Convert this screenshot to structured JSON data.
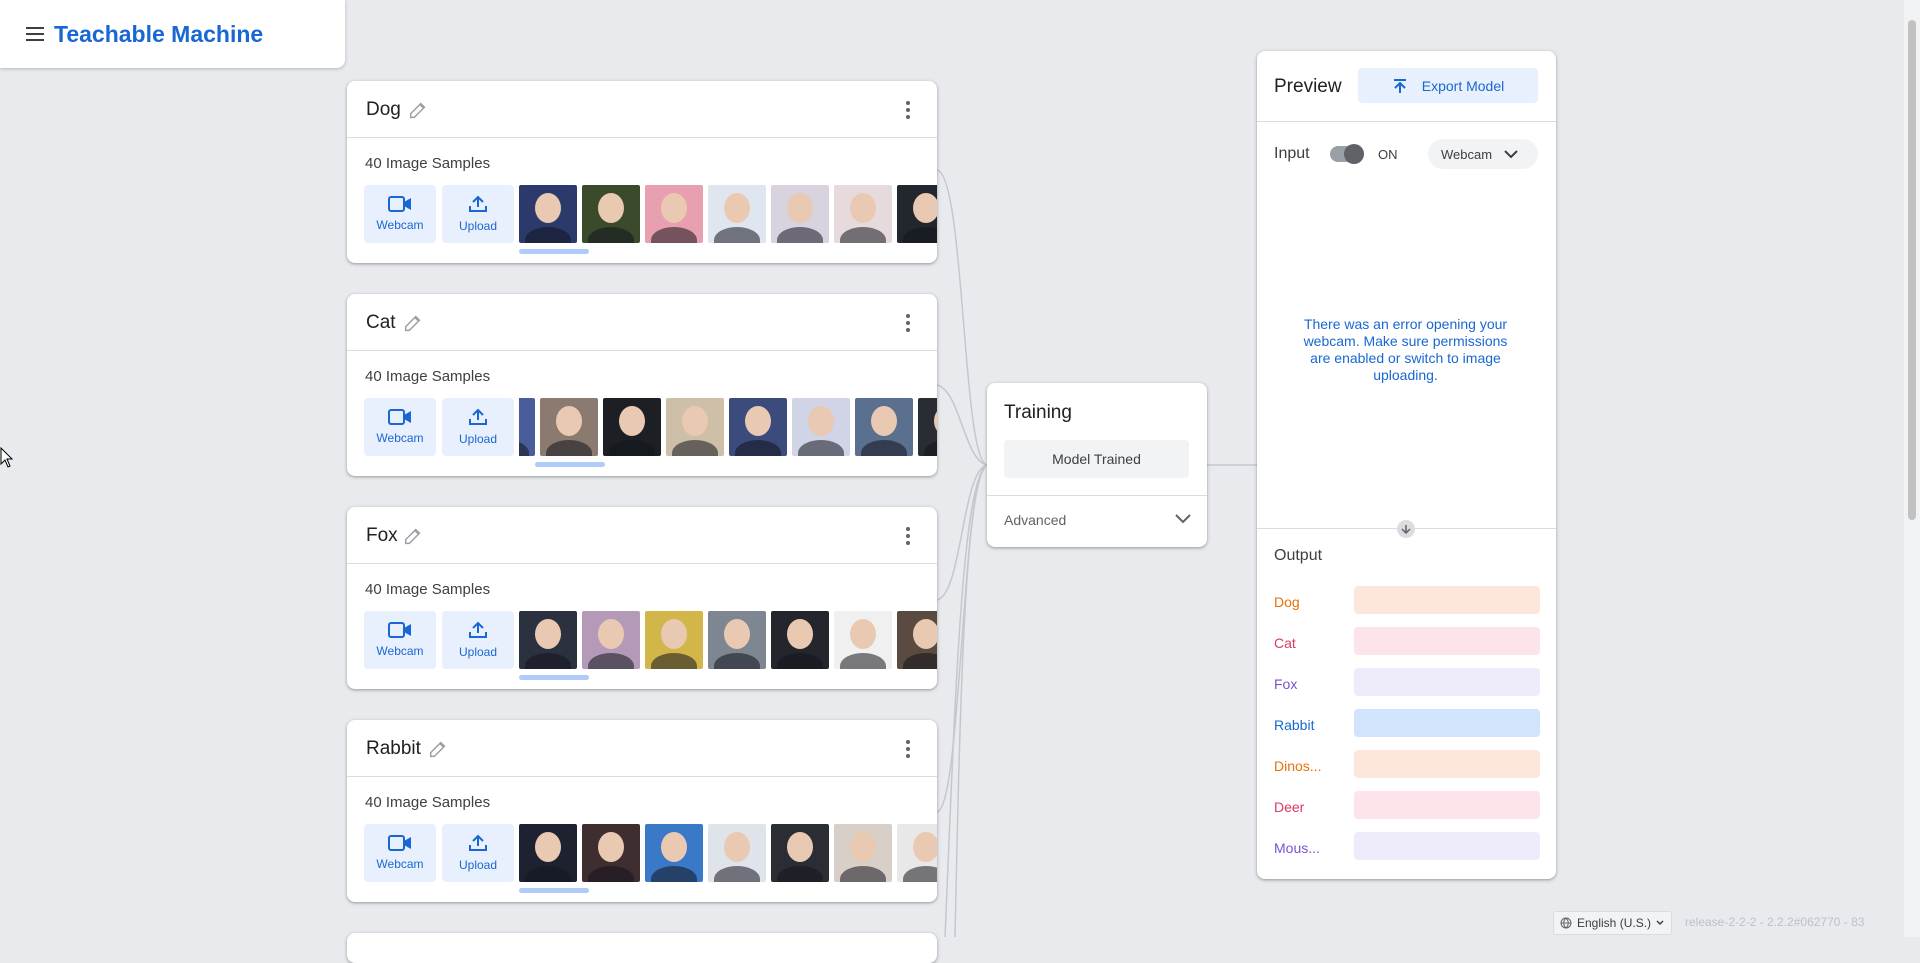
{
  "app": {
    "title": "Teachable Machine"
  },
  "classes": [
    {
      "name": "Dog",
      "samples_label": "40 Image Samples",
      "webcam_label": "Webcam",
      "upload_label": "Upload",
      "thumb_colors": [
        "#2b3a6b",
        "#3a4a2a",
        "#e8a0b0",
        "#dfe6f0",
        "#d9d3df",
        "#e6dadd",
        "#22262e"
      ]
    },
    {
      "name": "Cat",
      "samples_label": "40 Image Samples",
      "webcam_label": "Webcam",
      "upload_label": "Upload",
      "thumb_colors": [
        "#4a5d9a",
        "#8a7a70",
        "#1c1f24",
        "#cdbfa8",
        "#3b4b7c",
        "#d0d4e6",
        "#5b6f8e",
        "#2a2c33"
      ]
    },
    {
      "name": "Fox",
      "samples_label": "40 Image Samples",
      "webcam_label": "Webcam",
      "upload_label": "Upload",
      "thumb_colors": [
        "#2c3140",
        "#b49ab8",
        "#d2b64a",
        "#7d8691",
        "#23262c",
        "#f0f0f0",
        "#5a4a40"
      ]
    },
    {
      "name": "Rabbit",
      "samples_label": "40 Image Samples",
      "webcam_label": "Webcam",
      "upload_label": "Upload",
      "thumb_colors": [
        "#1e2230",
        "#3e2e30",
        "#3a78c8",
        "#dfe3ea",
        "#2a2d33",
        "#d7cfc8",
        "#e8e8e8"
      ]
    }
  ],
  "training": {
    "title": "Training",
    "button_label": "Model Trained",
    "advanced_label": "Advanced"
  },
  "preview": {
    "title": "Preview",
    "export_label": "Export Model",
    "input_label": "Input",
    "toggle_state": "ON",
    "source_label": "Webcam",
    "error_message": "There was an error opening your webcam. Make sure permissions are enabled or switch to image uploading.",
    "output_title": "Output",
    "outputs": [
      {
        "label": "Dog",
        "color": "#e8710a",
        "bar_color": "#fde7dd"
      },
      {
        "label": "Cat",
        "color": "#d93a61",
        "bar_color": "#fce4ea"
      },
      {
        "label": "Fox",
        "color": "#7a52d1",
        "bar_color": "#eeecfb"
      },
      {
        "label": "Rabbit",
        "color": "#1967d2",
        "bar_color": "#d2e3fc"
      },
      {
        "label": "Dinos...",
        "color": "#e8710a",
        "bar_color": "#fde7dd"
      },
      {
        "label": "Deer",
        "color": "#d93a61",
        "bar_color": "#fce4ea"
      },
      {
        "label": "Mous...",
        "color": "#7a52d1",
        "bar_color": "#eeecfb"
      }
    ]
  },
  "footer": {
    "language": "English (U.S.)",
    "version": "release-2-2-2 - 2.2.2#062770 - 83"
  },
  "colors": {
    "accent": "#1967d2",
    "background": "#e8eaed"
  },
  "icons": {
    "menu": "menu-icon",
    "edit": "pencil-icon",
    "more": "more-vert-icon",
    "webcam": "videocam-icon",
    "upload": "upload-icon",
    "export": "upload-icon",
    "chevron": "chevron-down-icon",
    "globe": "globe-icon"
  }
}
